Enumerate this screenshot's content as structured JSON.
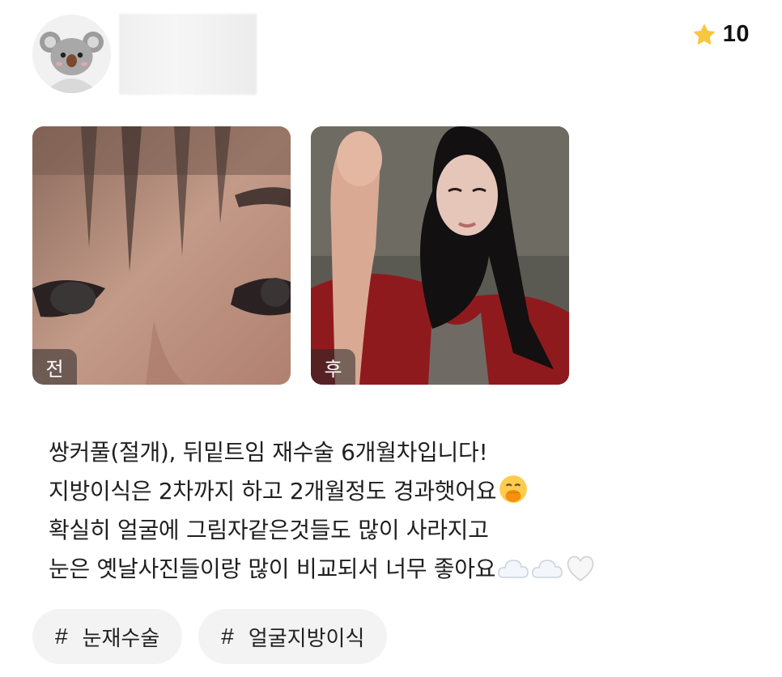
{
  "user": {
    "avatar_icon": "koala-avatar-icon"
  },
  "rating": {
    "icon": "star-icon",
    "value": "10",
    "star_color": "#F7C740"
  },
  "photos": [
    {
      "label": "전"
    },
    {
      "label": "후"
    }
  ],
  "review": {
    "lines": [
      "쌍커풀(절개), 뒤밑트임 재수술 6개월차입니다!",
      "지방이식은 2차까지 하고 2개월정도 경과햇어요",
      "확실히 얼굴에 그림자같은것들도 많이 사라지고",
      "눈은 옛날사진들이랑 많이 비교되서 너무 좋아요"
    ]
  },
  "tags": [
    {
      "hash": "#",
      "label": "눈재수술"
    },
    {
      "hash": "#",
      "label": "얼굴지방이식"
    }
  ]
}
